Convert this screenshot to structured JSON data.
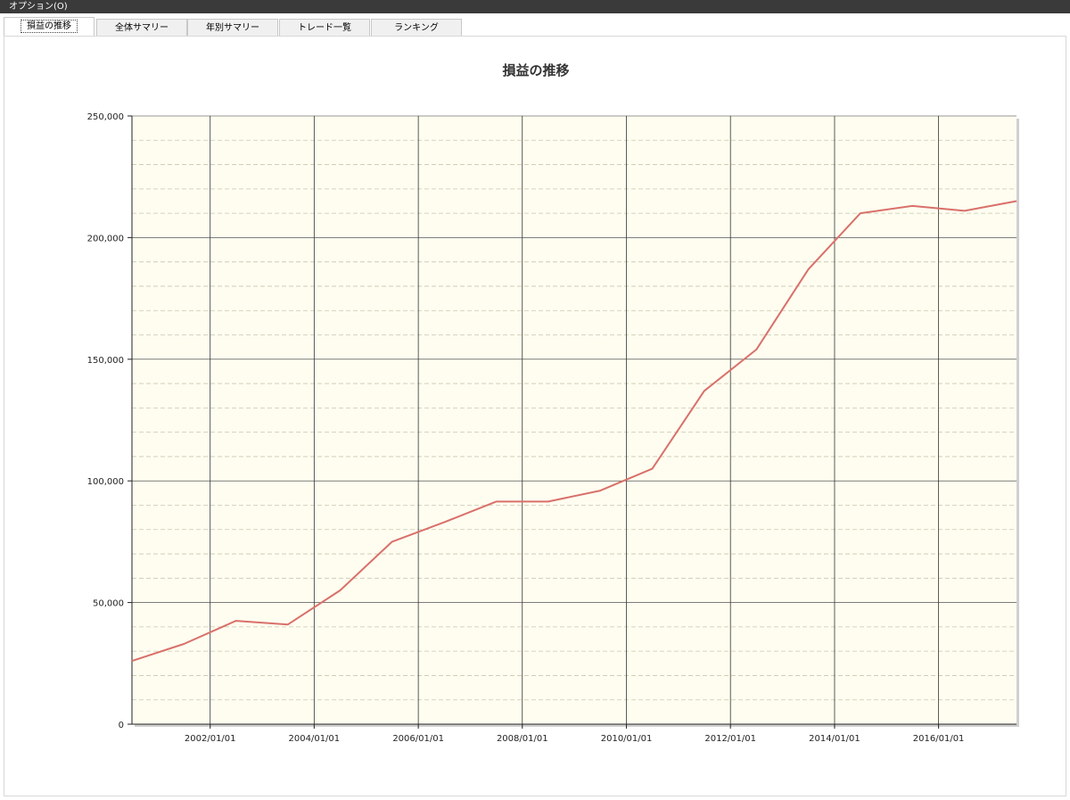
{
  "menubar": {
    "options_label": "オプション(O)"
  },
  "tabs": [
    {
      "label": "損益の推移",
      "active": true
    },
    {
      "label": "全体サマリー",
      "active": false
    },
    {
      "label": "年別サマリー",
      "active": false
    },
    {
      "label": "トレード一覧",
      "active": false
    },
    {
      "label": "ランキング",
      "active": false
    }
  ],
  "colors": {
    "plot_background": "#fefdf0",
    "line": "#d9706a",
    "major_grid": "#333333",
    "minor_grid": "#c8c8b0"
  },
  "chart_data": {
    "type": "line",
    "title": "損益の推移",
    "xlabel": "",
    "ylabel": "",
    "xlim": [
      "2000/07/01",
      "2017/07/01"
    ],
    "ylim": [
      0,
      250000
    ],
    "yticks": [
      0,
      50000,
      100000,
      150000,
      200000,
      250000
    ],
    "ytick_labels": [
      "0",
      "50,000",
      "100,000",
      "150,000",
      "200,000",
      "250,000"
    ],
    "xticks": [
      "2002/01/01",
      "2004/01/01",
      "2006/01/01",
      "2008/01/01",
      "2010/01/01",
      "2012/01/01",
      "2014/01/01",
      "2016/01/01"
    ],
    "grid": true,
    "series": [
      {
        "x": [
          "2000/07/01",
          "2001/07/01",
          "2002/07/01",
          "2003/07/01",
          "2004/07/01",
          "2005/07/01",
          "2006/07/01",
          "2007/07/01",
          "2008/07/01",
          "2009/07/01",
          "2010/07/01",
          "2011/07/01",
          "2012/07/01",
          "2013/07/01",
          "2014/07/01",
          "2015/07/01",
          "2016/07/01",
          "2017/07/01"
        ],
        "values": [
          26000,
          33000,
          42500,
          41000,
          55000,
          75000,
          83000,
          91500,
          91500,
          96000,
          105000,
          137000,
          154000,
          187000,
          210000,
          213000,
          211000,
          215000
        ]
      }
    ]
  }
}
